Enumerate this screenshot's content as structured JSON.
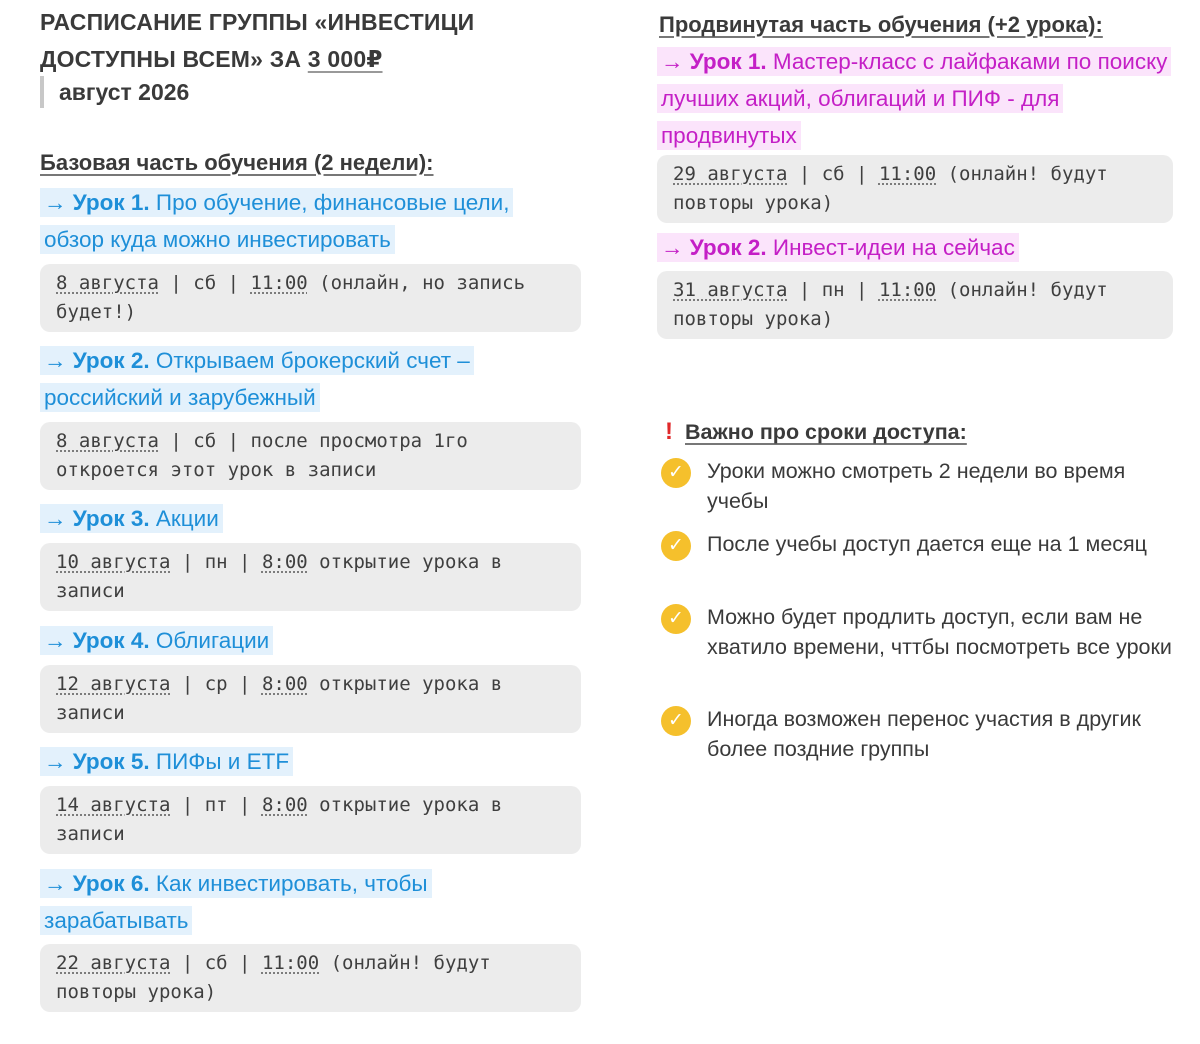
{
  "header": {
    "title_part1": "РАСПИСАНИЕ ГРУППЫ «ИНВЕСТИЦИ ДОСТУПНЫ ВСЕМ» ЗА ",
    "price": "3 000₽",
    "subtitle": "август 2026"
  },
  "basic": {
    "heading": "Базовая часть обучения (2 недели):",
    "lessons": [
      {
        "num": "→ Урок 1.",
        "title": "Про обучение, финансовые цели, обзор куда можно инвестировать",
        "date": "8 августа",
        "sep1": "| сб |",
        "time": "11:00",
        "note": "(онлайн, но запись будет!)"
      },
      {
        "num": "→ Урок 2.",
        "title": "Открываем брокерский счет – российский и зарубежный",
        "date": "8 августа",
        "sep1": "| сб |",
        "time": "",
        "note": "после просмотра 1го откроется этот урок в записи"
      },
      {
        "num": "→ Урок 3.",
        "title": "Акции",
        "date": "10 августа",
        "sep1": "| пн |",
        "time": "8:00",
        "note": "открытие урока в записи"
      },
      {
        "num": "→ Урок 4.",
        "title": "Облигации",
        "date": "12 августа",
        "sep1": "| ср |",
        "time": "8:00",
        "note": "открытие урока в записи"
      },
      {
        "num": "→ Урок 5.",
        "title": "ПИФы и ETF",
        "date": "14 августа",
        "sep1": "| пт |",
        "time": "8:00",
        "note": "открытие урока в записи"
      },
      {
        "num": "→ Урок 6.",
        "title": "Как инвестировать, чтобы зарабатывать",
        "date": "22 августа",
        "sep1": "| сб |",
        "time": "11:00",
        "note": "(онлайн! будут повторы урока)"
      }
    ]
  },
  "advanced": {
    "heading": "Продвинутая часть обучения (+2 урока):",
    "lessons": [
      {
        "num": "→ Урок 1.",
        "title": "Мастер-класс с лайфаками по поиску лучших акций, облигаций и ПИФ - для продвинутых",
        "date": "29 августа",
        "sep1": "| сб |",
        "time": "11:00",
        "note": "(онлайн! будут повторы урока)"
      },
      {
        "num": "→ Урок 2.",
        "title": "Инвест-идеи на сейчас",
        "date": "31 августа",
        "sep1": "| пн |",
        "time": "11:00",
        "note": "(онлайн! будут повторы урока)"
      }
    ]
  },
  "important": {
    "mark": "!",
    "heading": "Важно про сроки доступа:",
    "items": [
      "Уроки можно смотреть 2 недели во время учебы",
      "После учебы доступ дается еще на 1 месяц",
      "Можно будет продлить доступ, если вам не хватило времени, чттбы посмотреть все уроки",
      "Иногда возможен перенос участия в другик более поздние группы"
    ],
    "check_glyph": "✓"
  },
  "colors": {
    "basic_lesson": "#1e8fd8",
    "basic_highlight": "#e3f1fc",
    "advanced_lesson": "#c41fc6",
    "advanced_highlight": "#fbe4fb",
    "check_icon": "#f5c02c",
    "important_mark": "#e0282a"
  }
}
